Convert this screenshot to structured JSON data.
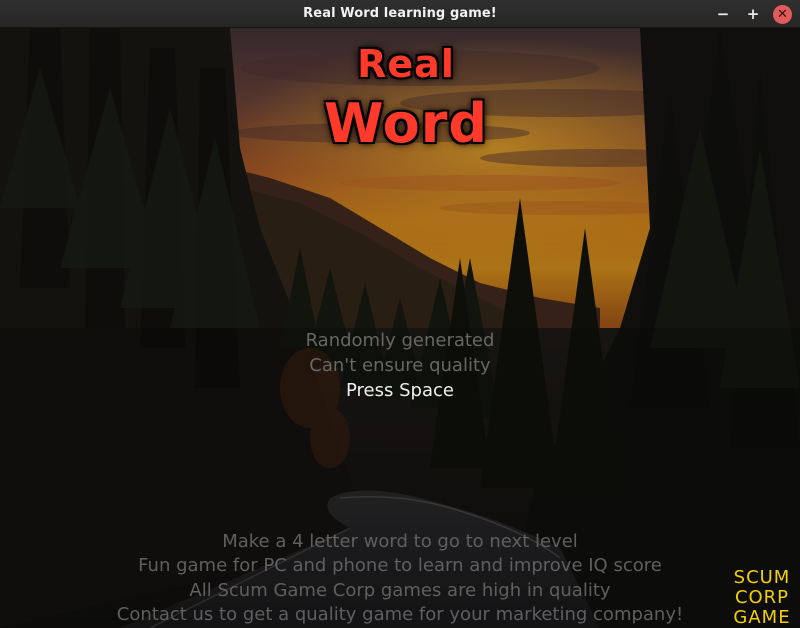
{
  "window": {
    "title": "Real Word learning game!",
    "minimize_icon": "minimize-icon",
    "maximize_icon": "maximize-icon",
    "close_icon": "close-icon",
    "minimize_glyph": "−",
    "maximize_glyph": "+",
    "close_glyph": "✕"
  },
  "logo": {
    "line1": "Real",
    "line2": "Word",
    "color": "#ff3a2a"
  },
  "menu": {
    "line1": "Randomly generated",
    "line2": "Can't ensure quality",
    "prompt": "Press Space"
  },
  "footer": {
    "lines": [
      "Make a 4 letter word to go to next level",
      "Fun game for PC and phone to learn and improve IQ score",
      "All Scum Game Corp games are high in quality",
      "Contact us to get a quality game for your marketing company!"
    ]
  },
  "badge": {
    "line1": "SCUM",
    "line2": "CORP",
    "line3": "GAME",
    "color": "#f5d000"
  },
  "background": {
    "description_icon": "forest-road-sunset-background"
  }
}
